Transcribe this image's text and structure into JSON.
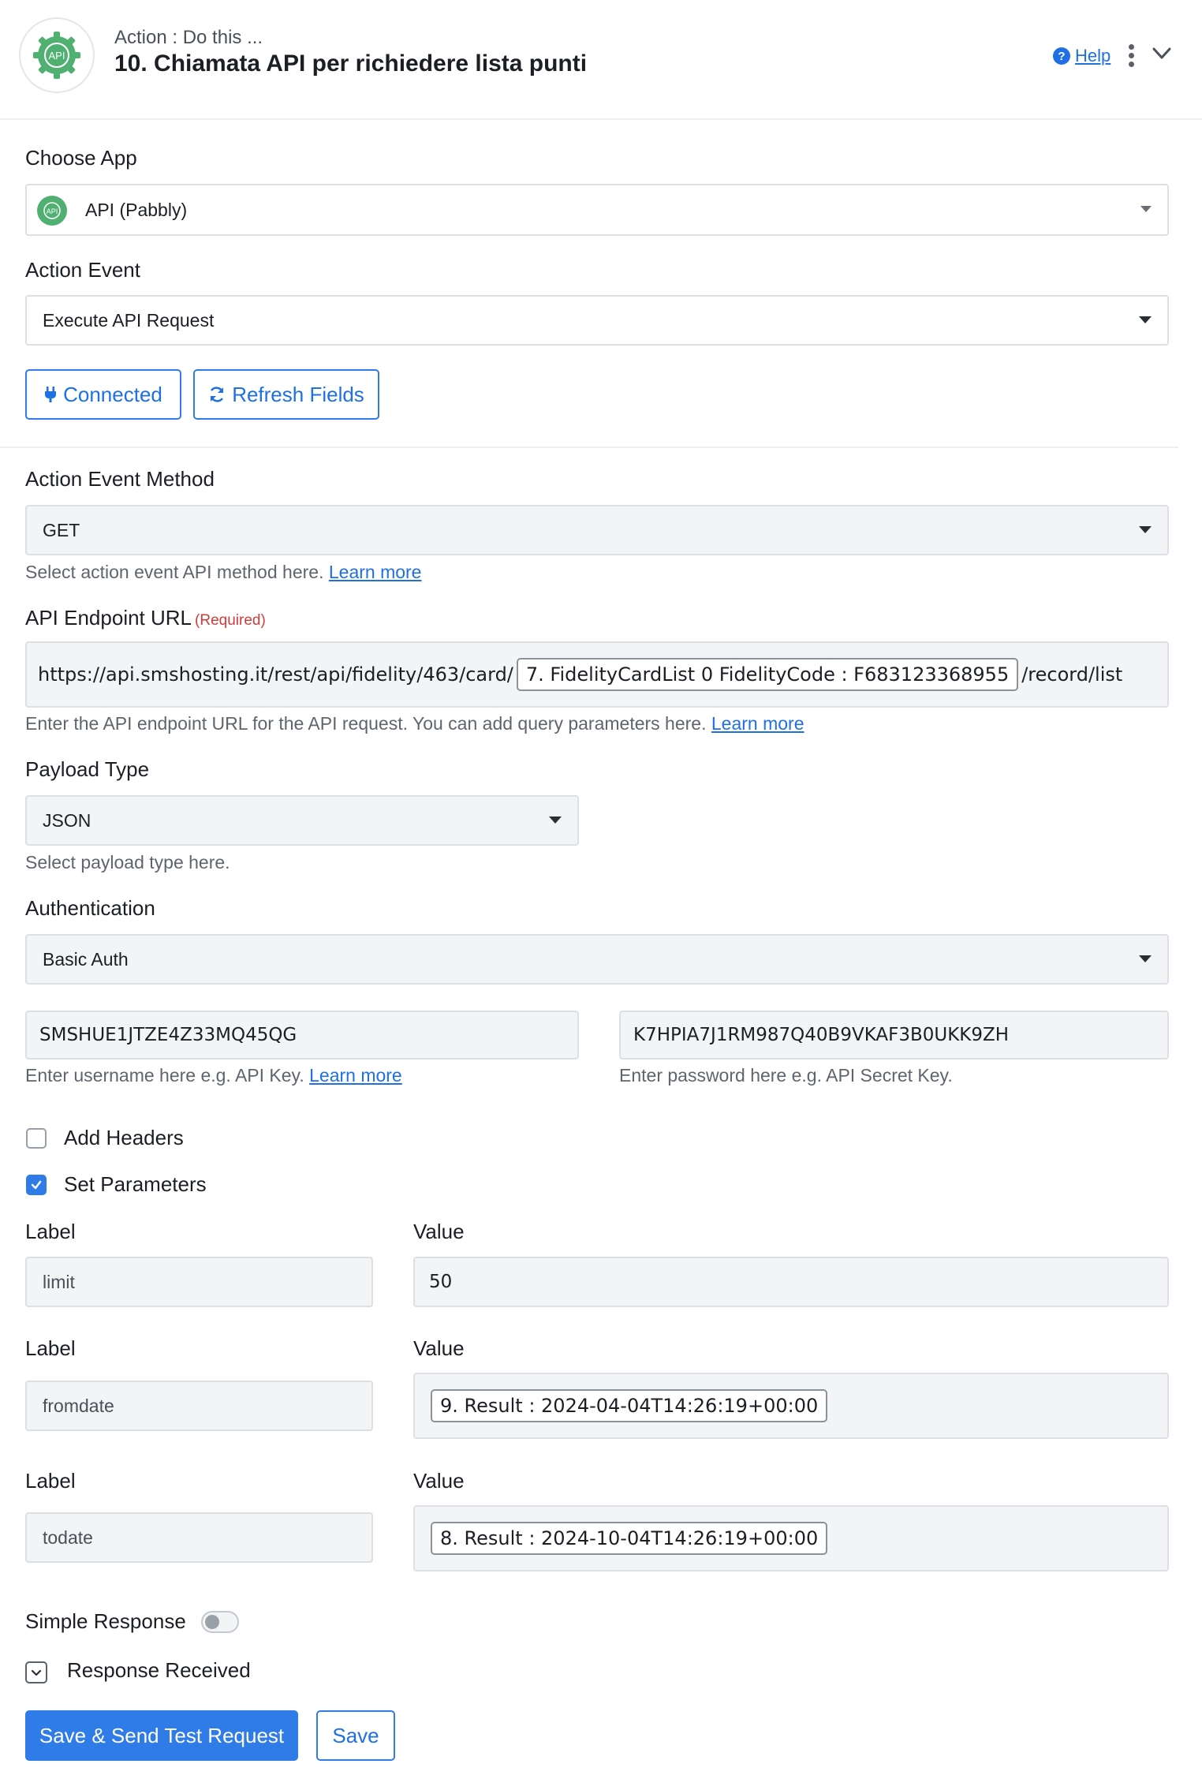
{
  "header": {
    "subtitle": "Action : Do this ...",
    "title": "10. Chiamata API per richiedere lista punti",
    "help_label": "Help",
    "help_icon": "question-circle-icon",
    "menu_icon": "kebab-menu-icon",
    "collapse_icon": "chevron-down-icon",
    "logo_text": "API"
  },
  "choose_app": {
    "label": "Choose App",
    "value": "API (Pabbly)",
    "icon_text": "API"
  },
  "action_event": {
    "label": "Action Event",
    "value": "Execute API Request"
  },
  "buttons": {
    "connected": "Connected",
    "refresh": "Refresh Fields",
    "save_send": "Save & Send Test Request",
    "save": "Save"
  },
  "method": {
    "label": "Action Event Method",
    "value": "GET",
    "help": "Select action event API method here.",
    "learn_more": "Learn more"
  },
  "endpoint": {
    "label": "API Endpoint URL",
    "required": "(Required)",
    "prefix": "https://api.smshosting.it/rest/api/fidelity/463/card/",
    "chip": "7. FidelityCardList 0 FidelityCode : F683123368955",
    "suffix": "/record/list",
    "help": "Enter the API endpoint URL for the API request. You can add query parameters here.",
    "learn_more": "Learn more"
  },
  "payload": {
    "label": "Payload Type",
    "value": "JSON",
    "help": "Select payload type here."
  },
  "auth": {
    "label": "Authentication",
    "value": "Basic Auth",
    "username": "SMSHUE1JTZE4Z33MQ45QG",
    "password": "K7HPIA7J1RM987Q40B9VKAF3B0UKK9ZH",
    "username_help": "Enter username here e.g. API Key.",
    "learn_more": "Learn more",
    "password_help": "Enter password here e.g. API Secret Key."
  },
  "options": {
    "add_headers": "Add Headers",
    "set_parameters": "Set Parameters",
    "add_headers_checked": false,
    "set_parameters_checked": true
  },
  "params": {
    "label_header": "Label",
    "value_header": "Value",
    "rows": [
      {
        "label": "limit",
        "value": "50"
      },
      {
        "label": "fromdate",
        "value": "9. Result : 2024-04-04T14:26:19+00:00"
      },
      {
        "label": "todate",
        "value": "8. Result : 2024-10-04T14:26:19+00:00"
      }
    ]
  },
  "simple_response": {
    "label": "Simple Response",
    "enabled": false
  },
  "response_received": {
    "label": "Response Received"
  },
  "colors": {
    "primary": "#2f7be8",
    "required": "#d33a3a",
    "logo_green": "#4fb071"
  }
}
